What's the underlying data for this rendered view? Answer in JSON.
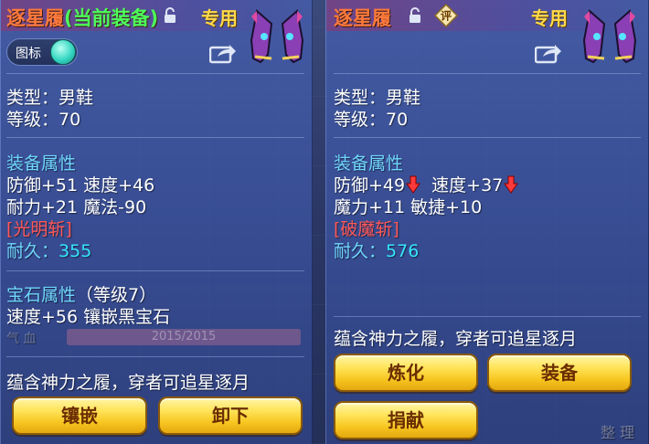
{
  "left_panel": {
    "name": "逐星履",
    "equipped_tag": "(当前装备)",
    "badge": "专用",
    "toggle_label": "图标",
    "type_line": "类型：男鞋",
    "level_line": "等级：70",
    "equip_attr_title": "装备属性",
    "attr_line_1": "防御+51 速度+46",
    "attr_line_2": "耐力+21 魔法-90",
    "special_skill": "[光明斩]",
    "durability_label": "耐久：",
    "durability_value": "355",
    "gem_attr_title": "宝石属性",
    "gem_level": "（等级7）",
    "gem_line": "速度+56 镶嵌黑宝石",
    "faint_hp_label": "气 血",
    "faint_hp_value": "2015/2015",
    "description": "蕴含神力之履，穿者可追星逐月",
    "buttons": {
      "inlay": "镶嵌",
      "unequip": "卸下"
    }
  },
  "right_panel": {
    "name": "逐星履",
    "eval_badge": "评",
    "badge": "专用",
    "type_line": "类型：男鞋",
    "level_line": "等级：70",
    "equip_attr_title": "装备属性",
    "attr_defense": "防御+49",
    "attr_speed": "速度+37",
    "attr_line_2": "魔力+11 敏捷+10",
    "special_skill": "[破魔斩]",
    "durability_label": "耐久：",
    "durability_value": "576",
    "description": "蕴含神力之履，穿者可追星逐月",
    "buttons": {
      "refine": "炼化",
      "equip": "装备",
      "donate": "捐献"
    },
    "faint_sort": "整 理"
  },
  "colors": {
    "name_orange": "#ff7a3c",
    "equipped_green": "#4dff5a",
    "badge_gold": "#ffd94a",
    "section_blue": "#6fd6ff",
    "skill_red": "#ff5858",
    "durability_cyan": "#35e6ff",
    "button_gold": "#ffe45a"
  },
  "icons": [
    "lock-open-icon",
    "share-icon",
    "shoe-item-icon",
    "eval-icon",
    "down-arrow-icon"
  ]
}
